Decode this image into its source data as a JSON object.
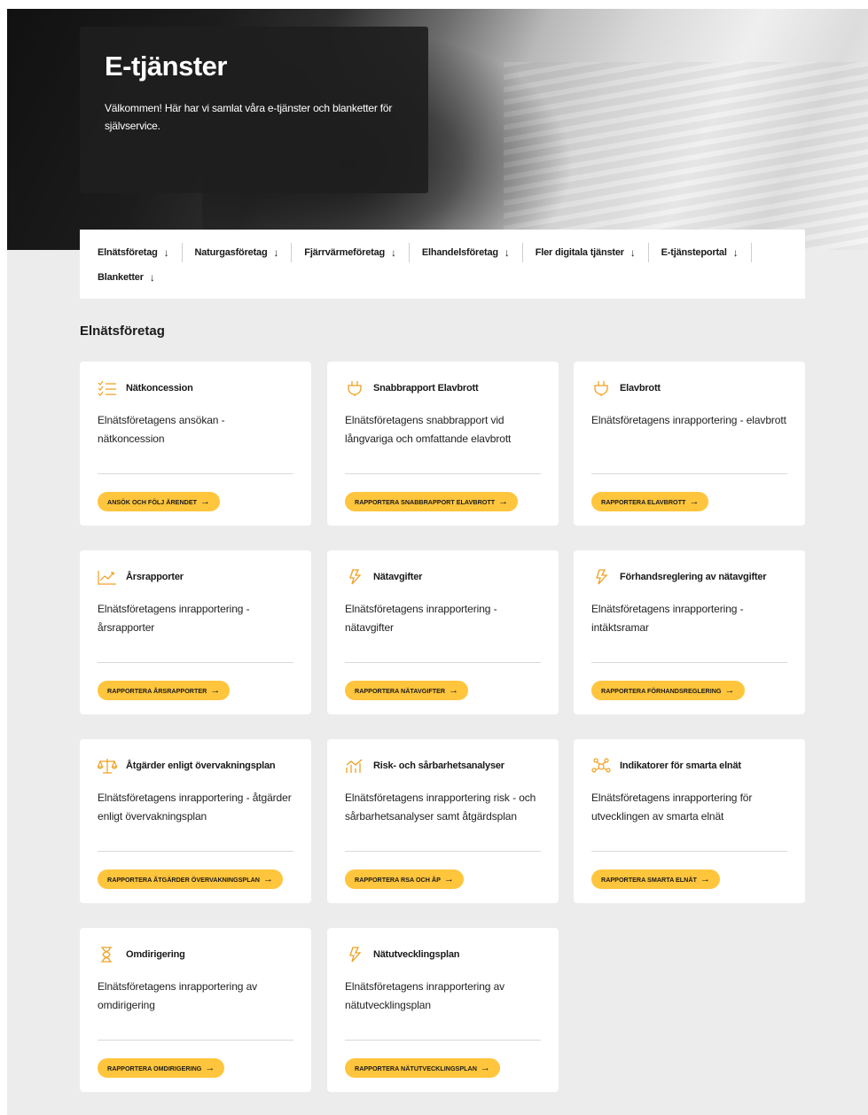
{
  "hero": {
    "title": "E-tjänster",
    "text": "Välkommen! Här har vi samlat våra e-tjänster och blanketter för självservice."
  },
  "nav": {
    "arrow": "↓",
    "items": [
      "Elnätsföretag",
      "Naturgasföretag",
      "Fjärrvärmeföretag",
      "Elhandelsföretag",
      "Fler digitala tjänster",
      "E-tjänsteportal",
      "Blanketter"
    ]
  },
  "section": {
    "title": "Elnätsföretag"
  },
  "colors": {
    "accent": "#ffc53d",
    "icon": "#f0a020",
    "background": "#ececec"
  },
  "button_arrow": "→",
  "cards": [
    {
      "icon": "checklist-icon",
      "title": "Nätkoncession",
      "desc": "Elnätsföretagens ansökan - nätkoncession",
      "button": "ANSÖK OCH FÖLJ ÄRENDET"
    },
    {
      "icon": "plug-icon",
      "title": "Snabbrapport Elavbrott",
      "desc": "Elnätsföretagens snabbrapport vid långvariga och omfattande elavbrott",
      "button": "RAPPORTERA SNABBRAPPORT ELAVBROTT"
    },
    {
      "icon": "plug-icon",
      "title": "Elavbrott",
      "desc": "Elnätsföretagens inrapportering - elavbrott",
      "button": "RAPPORTERA ELAVBROTT"
    },
    {
      "icon": "chart-line-icon",
      "title": "Årsrapporter",
      "desc": "Elnätsföretagens inrapportering - årsrapporter",
      "button": "RAPPORTERA ÅRSRAPPORTER"
    },
    {
      "icon": "lightning-icon",
      "title": "Nätavgifter",
      "desc": "Elnätsföretagens inrapportering - nätavgifter",
      "button": "RAPPORTERA NÄTAVGIFTER"
    },
    {
      "icon": "lightning-icon",
      "title": "Förhandsreglering av nätavgifter",
      "desc": "Elnätsföretagens inrapportering - intäktsramar",
      "button": "RAPPORTERA FÖRHANDSREGLERING"
    },
    {
      "icon": "scale-icon",
      "title": "Åtgärder enligt övervakningsplan",
      "desc": "Elnätsföretagens inrapportering - åtgärder enligt övervakningsplan",
      "button": "RAPPORTERA ÅTGÄRDER ÖVERVAKNINGSPLAN"
    },
    {
      "icon": "bar-chart-icon",
      "title": "Risk- och sårbarhetsanalyser",
      "desc": "Elnätsföretagens inrapportering risk - och sårbarhetsanalyser samt åtgärdsplan",
      "button": "RAPPORTERA RSA OCH ÅP"
    },
    {
      "icon": "network-icon",
      "title": "Indikatorer för smarta elnät",
      "desc": "Elnätsföretagens inrapportering för utvecklingen av smarta elnät",
      "button": "RAPPORTERA SMARTA ELNÄT"
    },
    {
      "icon": "hourglass-icon",
      "title": "Omdirigering",
      "desc": "Elnätsföretagens inrapportering av omdirigering",
      "button": "RAPPORTERA OMDIRIGERING"
    },
    {
      "icon": "lightning-icon",
      "title": "Nätutvecklingsplan",
      "desc": "Elnätsföretagens inrapportering av nätutvecklingsplan",
      "button": "RAPPORTERA NÄTUTVECKLINGSPLAN"
    }
  ]
}
